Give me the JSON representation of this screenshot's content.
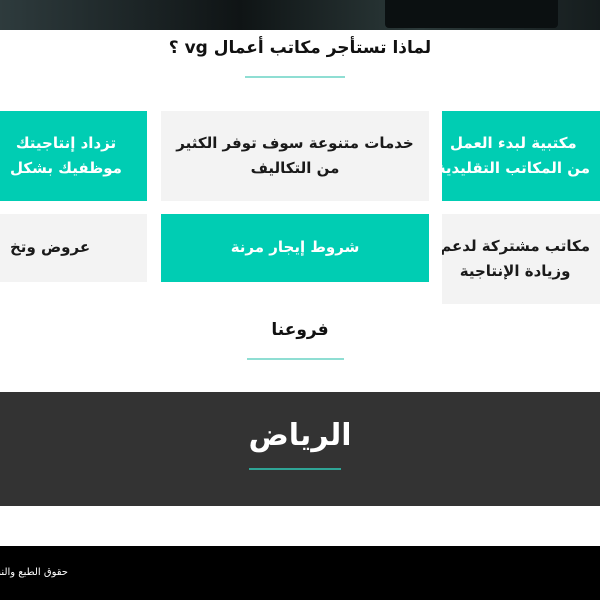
{
  "section": {
    "title": "لماذا تستأجر مكاتب أعمال vg ؟"
  },
  "features": [
    {
      "lines": [
        "مكتبية لبدء العمل",
        "من المكاتب التقليدية"
      ]
    },
    {
      "lines": [
        "خدمات متنوعة سوف توفر الكثير",
        "من التكاليف"
      ]
    },
    {
      "lines": [
        "تزداد إنتاجيتك",
        "موظفيك بشكل"
      ]
    },
    {
      "lines": [
        "مكاتب مشتركة لدعم",
        "وزيادة الإنتاجية"
      ]
    },
    {
      "lines": [
        "شروط إيجار مرنة"
      ]
    },
    {
      "lines": [
        "عروض وتخ"
      ]
    }
  ],
  "branches": {
    "title": "فروعنا",
    "name": "الرياض"
  },
  "footer": {
    "copyright": "حقوق الطبع والنشر"
  },
  "colors": {
    "accent": "#00cdb3",
    "card_gray": "#f3f3f3",
    "branch_bg": "#333333",
    "footer_bg": "#000000"
  }
}
